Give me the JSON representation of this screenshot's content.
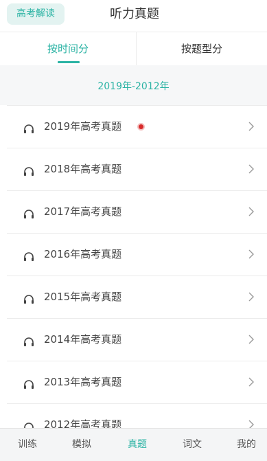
{
  "header": {
    "badge": "高考解读",
    "title": "听力真题"
  },
  "tabs": [
    {
      "label": "按时间分",
      "active": true
    },
    {
      "label": "按题型分",
      "active": false
    }
  ],
  "section": {
    "title": "2019年-2012年"
  },
  "list": [
    {
      "label": "2019年高考真题",
      "has_dot": true
    },
    {
      "label": "2018年高考真题",
      "has_dot": false
    },
    {
      "label": "2017年高考真题",
      "has_dot": false
    },
    {
      "label": "2016年高考真题",
      "has_dot": false
    },
    {
      "label": "2015年高考真题",
      "has_dot": false
    },
    {
      "label": "2014年高考真题",
      "has_dot": false
    },
    {
      "label": "2013年高考真题",
      "has_dot": false
    },
    {
      "label": "2012年高考真题",
      "has_dot": false
    }
  ],
  "tabbar": [
    {
      "label": "训练",
      "active": false
    },
    {
      "label": "模拟",
      "active": false
    },
    {
      "label": "真题",
      "active": true
    },
    {
      "label": "词文",
      "active": false
    },
    {
      "label": "我的",
      "active": false
    }
  ],
  "colors": {
    "accent": "#2bb3a4",
    "dot": "#d82a2a"
  },
  "icons": {
    "list_item": "headphones-icon",
    "list_chevron": "chevron-right-icon",
    "new_indicator": "red-dot"
  }
}
